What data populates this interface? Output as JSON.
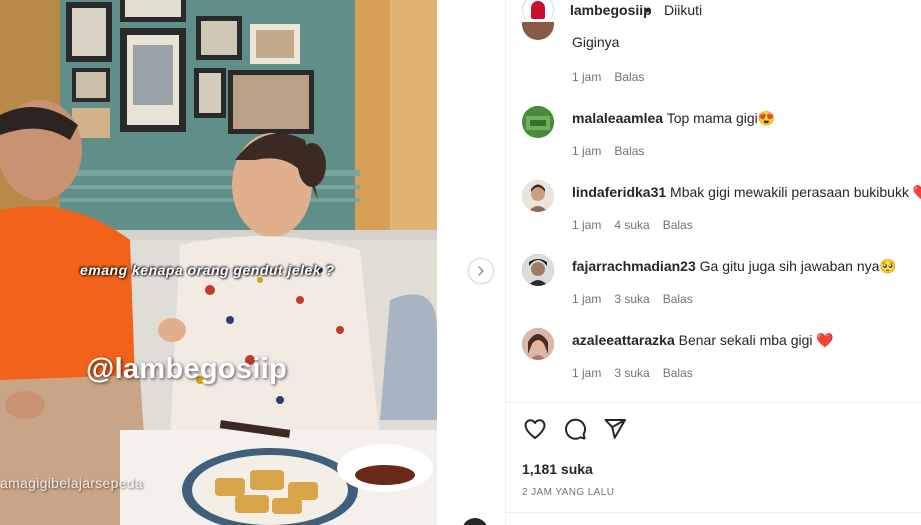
{
  "video": {
    "caption": "emang kenapa orang gendut jelek ?",
    "watermark": "@lambegosiip",
    "handle_overlay": "amagigibelajarsepeda"
  },
  "header": {
    "username": "lambegosiip",
    "separator": "•",
    "follow_status": "Diikuti"
  },
  "comments": [
    {
      "username": "",
      "text": "Giginya",
      "time": "1 jam",
      "likes": "",
      "reply": "Balas",
      "avatar_color": "#8a5a48"
    },
    {
      "username": "malaleaamlea",
      "text": "Top mama gigi",
      "emoji": "😍",
      "time": "1 jam",
      "likes": "",
      "reply": "Balas",
      "avatar_color": "#4a8a3c"
    },
    {
      "username": "lindaferidka31",
      "text": "Mbak gigi mewakili perasaan bukibukk",
      "emoji": "❤️",
      "time": "1 jam",
      "likes": "4 suka",
      "reply": "Balas",
      "avatar_color": "#c9a07e"
    },
    {
      "username": "fajarrachmadian23",
      "text": "Ga gitu juga sih jawaban nya",
      "emoji": "🥺",
      "time": "1 jam",
      "likes": "3 suka",
      "reply": "Balas",
      "avatar_color": "#3a3a3a"
    },
    {
      "username": "azaleeattarazka",
      "text": "Benar sekali mba gigi",
      "emoji": "❤️",
      "time": "1 jam",
      "likes": "3 suka",
      "reply": "Balas",
      "avatar_color": "#b5786a"
    }
  ],
  "actions": {
    "like_icon": "heart-outline-icon",
    "comment_icon": "comment-bubble-icon",
    "share_icon": "paper-plane-icon"
  },
  "stats": {
    "likes": "1,181 suka",
    "posted": "2 JAM YANG LALU"
  },
  "colors": {
    "primary_text": "#262626",
    "secondary_text": "#737373",
    "heart_red": "#ed4956",
    "border": "#efefef"
  }
}
